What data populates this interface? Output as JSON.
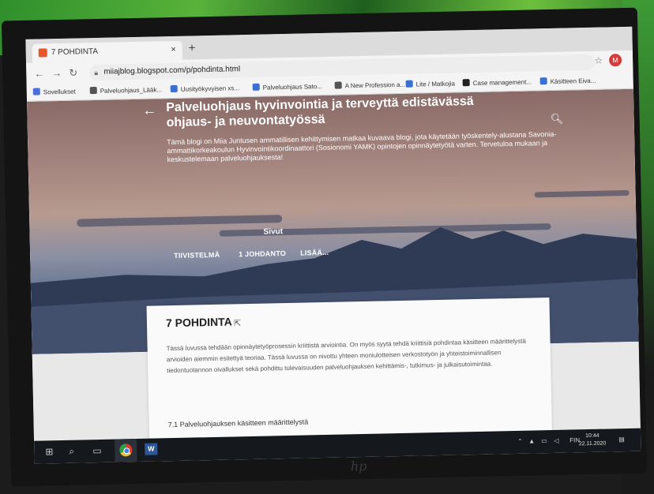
{
  "browser": {
    "tab_title": "7 POHDINTA",
    "tab_close": "×",
    "new_tab": "+",
    "url": "miiajblog.blogspot.com/p/pohdinta.html",
    "bookmarks": [
      "Sovellukset",
      "Palveluohjaus_Lääk...",
      "Uusityökyvyisen xs...",
      "Palveluohjaus Sato...",
      "A New Profession a...",
      "Lite / Matkojia",
      "Case management...",
      "Käsitteen Eiva..."
    ],
    "profile_initial": "M"
  },
  "blog": {
    "title": "Palveluohjaus hyvinvointia ja terveyttä edistävässä ohjaus- ja neuvontatyössä",
    "description": "Tämä blogi on Miia Juntusen ammatillisen kehittymisen matkaa kuvaava blogi, jota käytetään työskentely-alustana Savonia-ammattikorkeakoulun Hyvinvointikoordinaattori (Sosionomi YAMK) opintojen opinnäytetyötä varten. Tervetuloa mukaan ja keskustelemaan palveluohjauksesta!",
    "pages_label": "Sivut",
    "nav": [
      "TIIVISTELMÄ",
      "1 JOHDANTO",
      "LISÄÄ..."
    ]
  },
  "post": {
    "title": "7 POHDINTA",
    "body": "Tässä luvussa tehdään opinnäytetyöprosessin kriittistä arviointia. On myös syytä tehdä kriittisiä pohdintaa käsitteen määrittelystä arvioiden aiemmin esitettyä teoriaa. Tässä luvussa on nivottu yhteen moniulotteisen verkostotyön ja yhteistoiminnallisen tiedontuotannon oivallukset sekä pohdittu tulevaisuuden palveluohjauksen kehittämis-, tutkimus- ja julkaisutoimintaa.",
    "subheading": "7.1 Palveluohjauksen käsitteen määrittelystä"
  },
  "taskbar": {
    "language": "FIN",
    "time": "10:44",
    "date": "22.11.2020"
  },
  "monitor": {
    "brand": "hp"
  }
}
